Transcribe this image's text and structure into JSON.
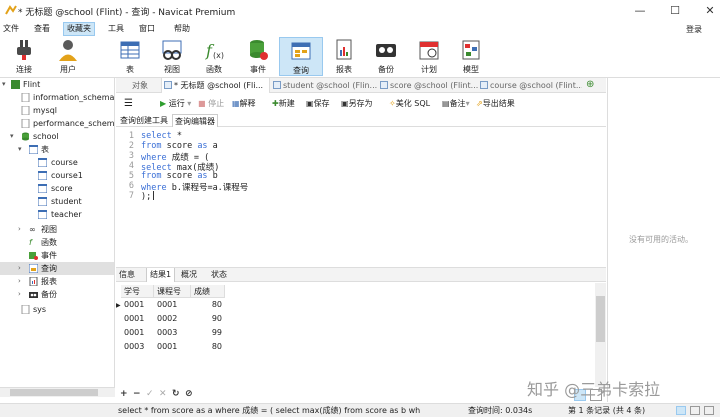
{
  "window": {
    "title": "* 无标题 @school (Flint) - 查询 - Navicat Premium",
    "controls": {
      "minimize": "—",
      "maximize": "☐",
      "close": "✕"
    }
  },
  "menu": {
    "items": [
      "文件",
      "查看",
      "收藏夹",
      "工具",
      "窗口",
      "帮助"
    ],
    "login": "登录"
  },
  "toolbar": {
    "buttons": [
      "连接",
      "用户",
      "表",
      "视图",
      "函数",
      "事件",
      "查询",
      "报表",
      "备份",
      "计划",
      "模型"
    ]
  },
  "sidebar": {
    "connection": "Flint",
    "databases": [
      "information_schema",
      "mysql",
      "performance_schema"
    ],
    "school": "school",
    "tables_label": "表",
    "tables": [
      "course",
      "course1",
      "score",
      "student",
      "teacher"
    ],
    "views": "视图",
    "functions": "函数",
    "events": "事件",
    "queries": "查询",
    "reports": "报表",
    "backups": "备份",
    "sys": "sys"
  },
  "tabs": {
    "objects": "对象",
    "items": [
      "* 无标题 @school (Fli...",
      "student @school (Flin...",
      "score @school (Flint...",
      "course @school (Flint..."
    ]
  },
  "query_toolbar": {
    "run": "运行",
    "stop": "停止",
    "explain": "解释",
    "new": "新建",
    "save": "保存",
    "save_as": "另存为",
    "beautify": "美化 SQL",
    "comment": "备注",
    "export": "导出结果"
  },
  "subtabs": {
    "builder": "查询创建工具",
    "editor": "查询编辑器"
  },
  "editor": {
    "line_numbers": [
      "1",
      "2",
      "3",
      "4",
      "5",
      "6",
      "7"
    ],
    "lines": [
      [
        {
          "t": "select",
          "k": true
        },
        {
          "t": " *",
          "k": false
        }
      ],
      [
        {
          "t": "from",
          "k": true
        },
        {
          "t": " score ",
          "k": false
        },
        {
          "t": "as",
          "k": true
        },
        {
          "t": " a",
          "k": false
        }
      ],
      [
        {
          "t": "where",
          "k": true
        },
        {
          "t": " 成绩 = (",
          "k": false
        }
      ],
      [
        {
          "t": "select",
          "k": true
        },
        {
          "t": " max(成绩)",
          "k": false
        }
      ],
      [
        {
          "t": "from",
          "k": true
        },
        {
          "t": " score ",
          "k": false
        },
        {
          "t": "as",
          "k": true
        },
        {
          "t": " b",
          "k": false
        }
      ],
      [
        {
          "t": "where",
          "k": true
        },
        {
          "t": " b.课程号=a.课程号",
          "k": false
        }
      ],
      [
        {
          "t": ");",
          "k": false
        }
      ]
    ]
  },
  "result_tabs": [
    "信息",
    "结果1",
    "概况",
    "状态"
  ],
  "results": {
    "columns": [
      "学号",
      "课程号",
      "成绩"
    ],
    "rows": [
      [
        "0001",
        "0001",
        "80"
      ],
      [
        "0001",
        "0002",
        "90"
      ],
      [
        "0001",
        "0003",
        "99"
      ],
      [
        "0003",
        "0001",
        "80"
      ]
    ]
  },
  "right_panel": {
    "message": "没有可用的活动。"
  },
  "watermark": "知乎 @三弟卡索拉",
  "status": {
    "sql": "select * from score as a where 成绩 = ( select max(成绩) from score as b wh",
    "query_time": "查询时间: 0.034s",
    "record": "第 1 条记录 (共 4 条)"
  },
  "colors": {
    "accent": "#cde6f7",
    "keyword": "#3a6fd6",
    "run": "#2e9e2e"
  }
}
